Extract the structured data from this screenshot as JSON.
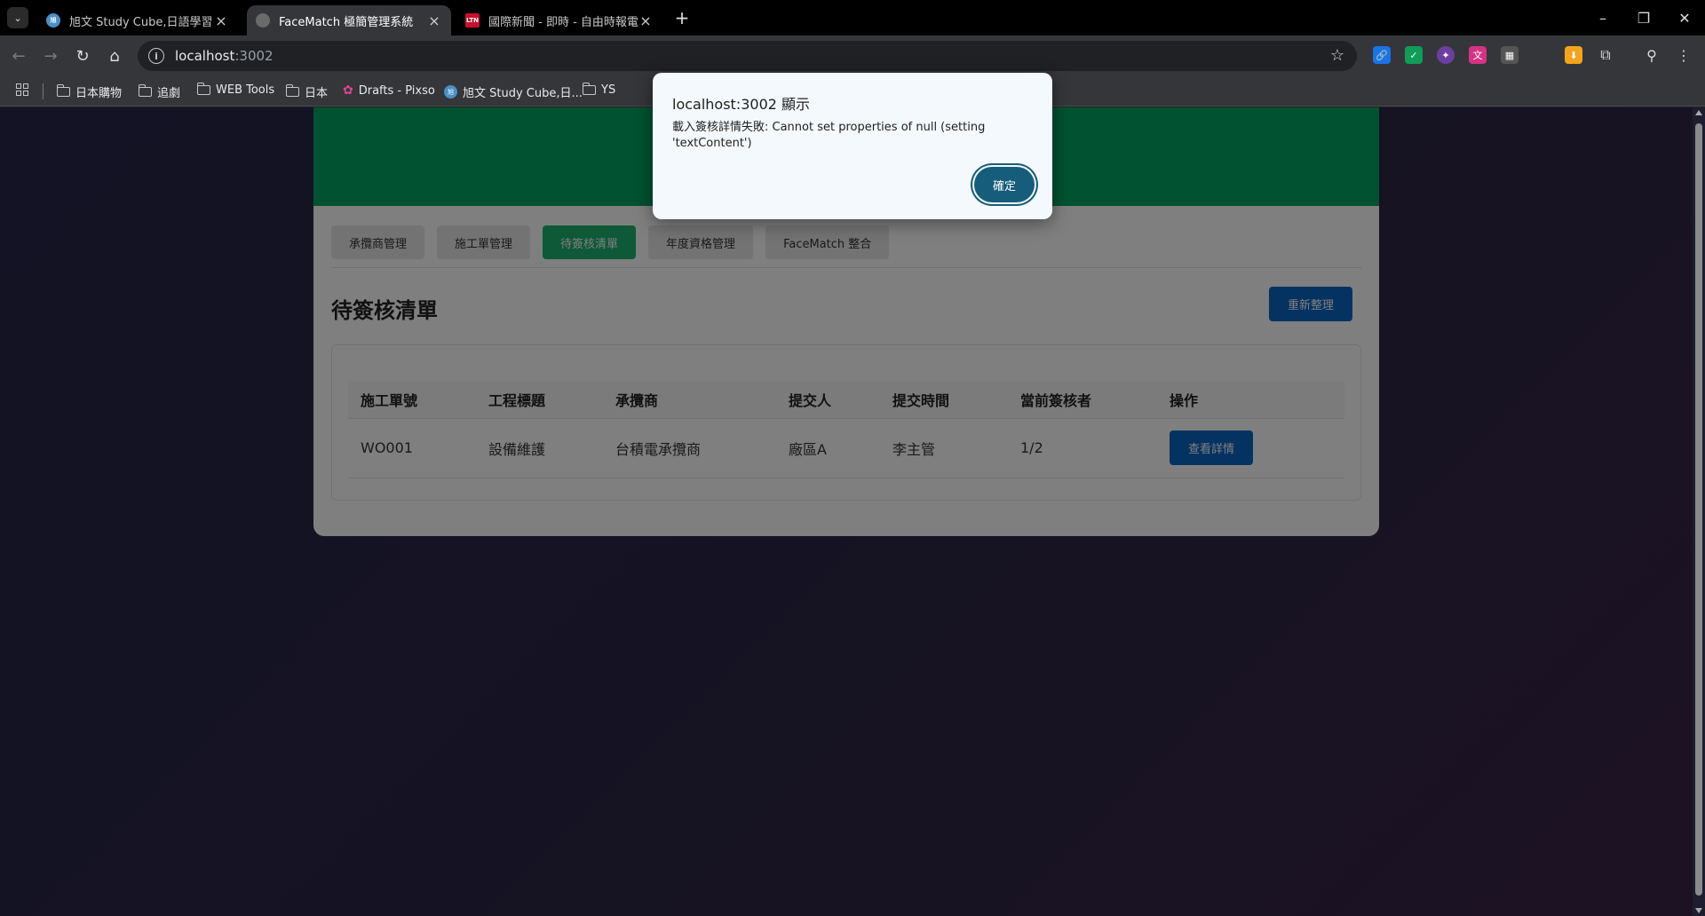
{
  "browser": {
    "tabs": [
      {
        "title": "旭文 Study Cube,日語學習百貨",
        "favicon": "globe-icon",
        "active": false
      },
      {
        "title": "FaceMatch 極簡管理系統",
        "favicon": "globe-icon",
        "active": true
      },
      {
        "title": "國際新聞 - 即時 - 自由時報電子",
        "favicon": "LTN",
        "active": false
      }
    ],
    "address": {
      "host": "localhost",
      "port": ":3002"
    },
    "bookmarks": [
      {
        "label": "日本購物",
        "icon": "folder-icon"
      },
      {
        "label": "追劇",
        "icon": "folder-icon"
      },
      {
        "label": "WEB Tools",
        "icon": "folder-icon"
      },
      {
        "label": "日本",
        "icon": "folder-icon"
      },
      {
        "label": "Drafts - Pixso",
        "icon": "pixso-icon"
      },
      {
        "label": "旭文 Study Cube,日...",
        "icon": "study-cube-icon"
      },
      {
        "label": "YS",
        "icon": "folder-icon"
      }
    ]
  },
  "app": {
    "nav_tabs": [
      "承攬商管理",
      "施工單管理",
      "待簽核清單",
      "年度資格管理",
      "FaceMatch 整合"
    ],
    "active_tab": "待簽核清單",
    "page_title": "待簽核清單",
    "refresh_label": "重新整理",
    "table": {
      "headers": [
        "施工單號",
        "工程標題",
        "承攬商",
        "提交人",
        "提交時間",
        "當前簽核者",
        "操作"
      ],
      "rows": [
        {
          "id": "WO001",
          "title": "設備維護",
          "contractor": "台積電承攬商",
          "submitter": "廠區A",
          "time": "李主管",
          "approver": "1/2",
          "action": "查看詳情"
        }
      ]
    },
    "colors": {
      "header_green": "#00a562",
      "active_tab": "#1ab370",
      "primary_button": "#0a66c2"
    }
  },
  "dialog": {
    "title": "localhost:3002 顯示",
    "message": "載入簽核詳情失敗: Cannot set properties of null (setting 'textContent')",
    "ok_label": "確定"
  }
}
